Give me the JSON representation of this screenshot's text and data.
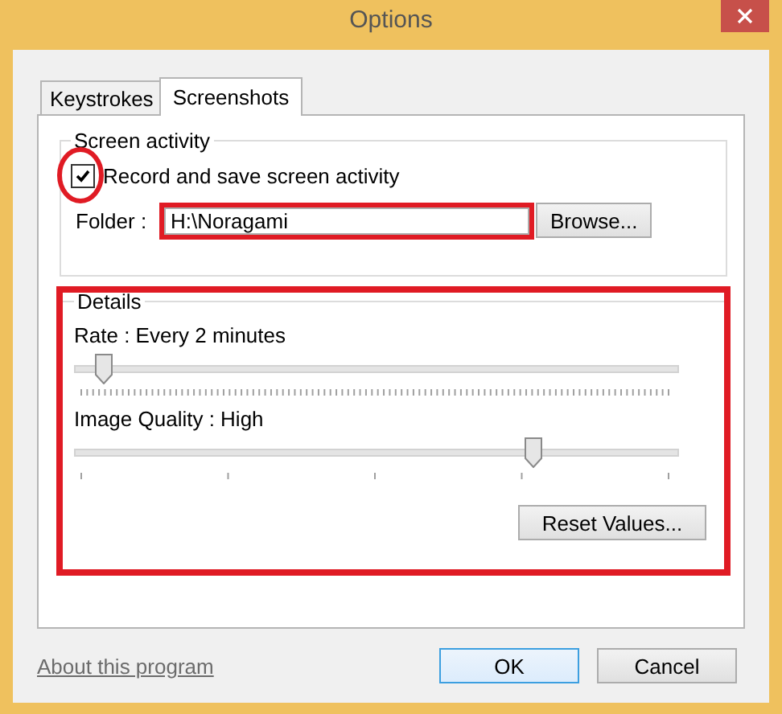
{
  "window": {
    "title": "Options"
  },
  "tabs": [
    {
      "label": "Keystrokes",
      "selected": false
    },
    {
      "label": "Screenshots",
      "selected": true
    }
  ],
  "screen_activity": {
    "title": "Screen activity",
    "record": {
      "label": "Record and save screen activity",
      "checked": true,
      "circled": true
    },
    "folder": {
      "label": "Folder :",
      "value": "H:\\Noragami",
      "boxed": true
    },
    "browse_button": "Browse..."
  },
  "details": {
    "title": "Details",
    "boxed": true,
    "sliders": [
      {
        "label": "Rate : Every 2 minutes",
        "level": 0.04,
        "kind": "dense"
      },
      {
        "label": "Image Quality : High",
        "level": 0.75,
        "kind": "sparse"
      }
    ],
    "reset_button": "Reset Values..."
  },
  "about_link": "About this program",
  "buttons": [
    {
      "label": "OK",
      "default": true
    },
    {
      "label": "Cancel",
      "default": false
    }
  ]
}
